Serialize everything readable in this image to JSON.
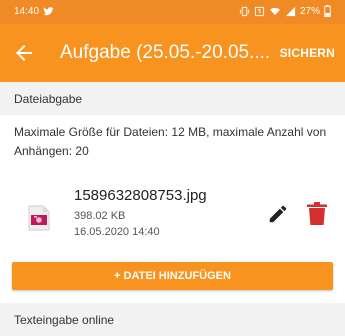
{
  "status_bar": {
    "time": "14:40",
    "battery": "27%",
    "icons": [
      "twitter-icon",
      "vibrate-icon",
      "nfc-icon",
      "wifi-icon",
      "signal-icon",
      "battery-icon"
    ]
  },
  "app_bar": {
    "title": "Aufgabe (25.05.-20.05....",
    "save_label": "SICHERN",
    "color": "#f7931e"
  },
  "file_submission": {
    "header": "Dateiabgabe",
    "info": "Maximale Größe für Dateien: 12 MB, maximale Anzahl von Anhängen: 20",
    "files": [
      {
        "name": "1589632808753.jpg",
        "size": "398.02 KB",
        "date": "16.05.2020 14:40"
      }
    ],
    "add_button_label": "+ DATEI HINZUFÜGEN"
  },
  "online_text": {
    "header": "Texteingabe online"
  },
  "colors": {
    "accent": "#f7931e",
    "delete": "#d32f2f",
    "section_bg": "#f2f2f2"
  }
}
